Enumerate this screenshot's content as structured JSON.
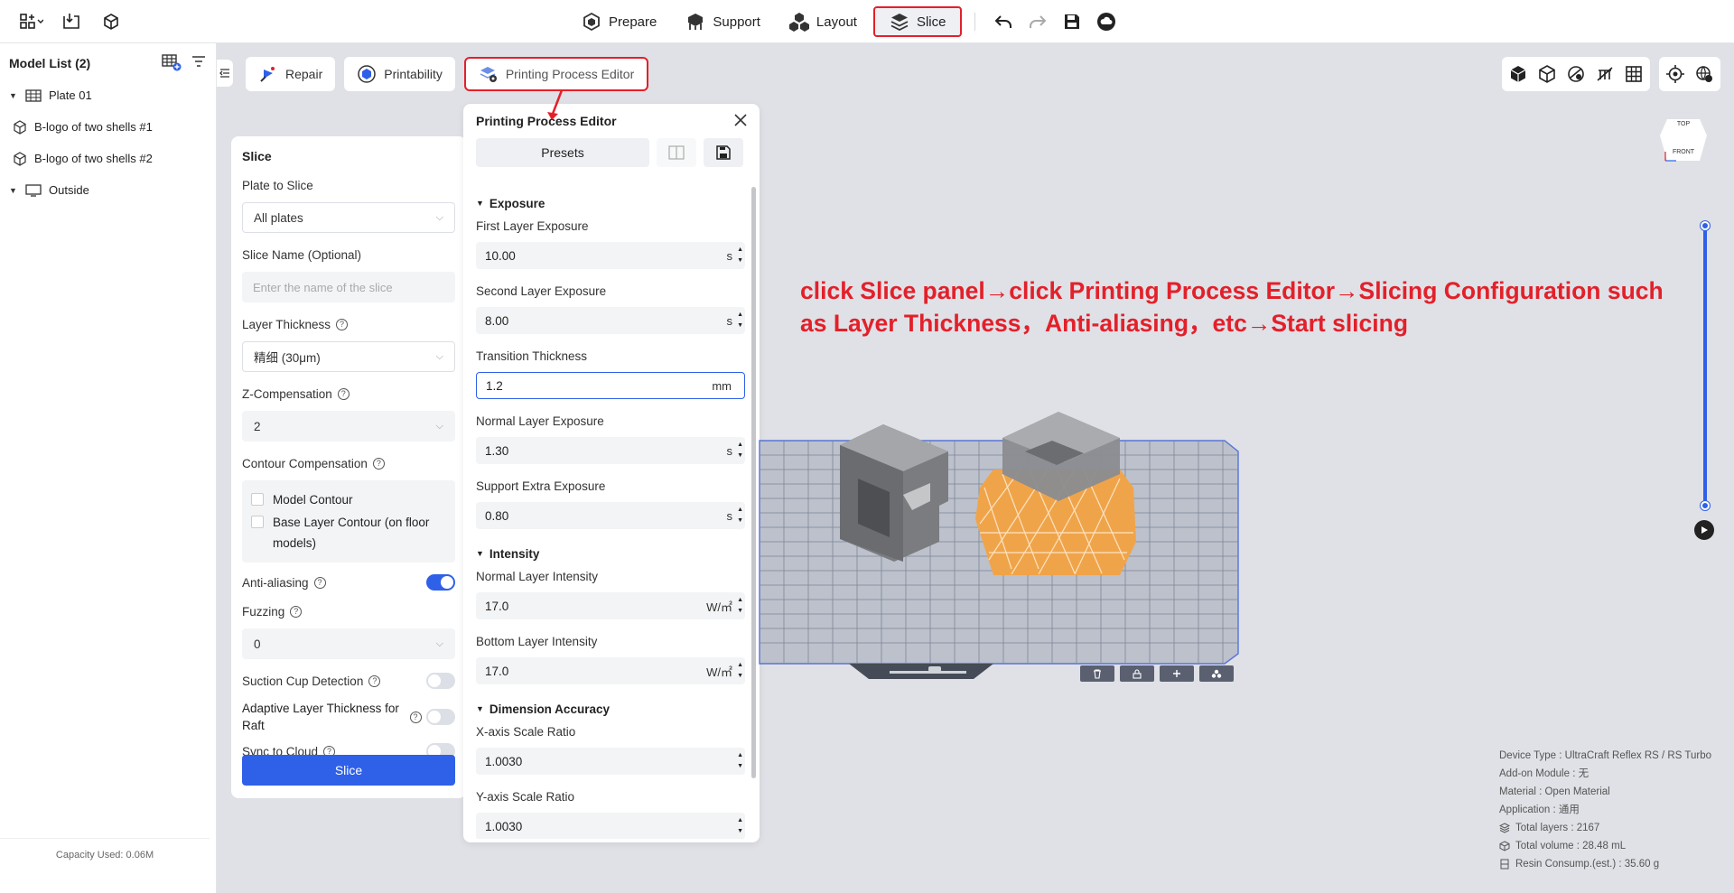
{
  "topbar": {
    "tabs": [
      {
        "label": "Prepare",
        "icon": "prepare-icon"
      },
      {
        "label": "Support",
        "icon": "support-icon"
      },
      {
        "label": "Layout",
        "icon": "layout-icon"
      },
      {
        "label": "Slice",
        "icon": "slice-icon",
        "active": true
      }
    ]
  },
  "model_list": {
    "title": "Model List (2)",
    "items": [
      {
        "label": "Plate 01",
        "type": "plate"
      },
      {
        "label": "B-logo of two shells #1",
        "type": "model"
      },
      {
        "label": "B-logo of two shells #2",
        "type": "model"
      },
      {
        "label": "Outside",
        "type": "outside"
      }
    ],
    "capacity": "Capacity Used: 0.06M"
  },
  "subtools": {
    "repair": "Repair",
    "printability": "Printability",
    "ppe": "Printing Process Editor"
  },
  "slice_panel": {
    "title": "Slice",
    "plate_to_slice_label": "Plate to Slice",
    "plate_to_slice_value": "All plates",
    "slice_name_label": "Slice Name (Optional)",
    "slice_name_placeholder": "Enter the name of the slice",
    "layer_thickness_label": "Layer Thickness",
    "layer_thickness_value": "精细 (30μm)",
    "z_comp_label": "Z-Compensation",
    "z_comp_value": "2",
    "contour_label": "Contour Compensation",
    "model_contour": "Model Contour",
    "base_contour": "Base Layer Contour (on floor models)",
    "anti_aliasing": "Anti-aliasing",
    "anti_aliasing_on": true,
    "fuzzing_label": "Fuzzing",
    "fuzzing_value": "0",
    "suction_cup": "Suction Cup Detection",
    "adaptive": "Adaptive Layer Thickness for Raft",
    "sync": "Sync to Cloud",
    "slice_button": "Slice"
  },
  "ppe_panel": {
    "title": "Printing Process Editor",
    "presets": "Presets",
    "sections": {
      "exposure": "Exposure",
      "intensity": "Intensity",
      "dimension": "Dimension Accuracy"
    },
    "fields": {
      "first_layer_exposure": {
        "label": "First Layer Exposure",
        "value": "10.00",
        "unit": "s"
      },
      "second_layer_exposure": {
        "label": "Second Layer Exposure",
        "value": "8.00",
        "unit": "s"
      },
      "transition_thickness": {
        "label": "Transition Thickness",
        "value": "1.2",
        "unit": "mm"
      },
      "normal_layer_exposure": {
        "label": "Normal Layer Exposure",
        "value": "1.30",
        "unit": "s"
      },
      "support_extra_exposure": {
        "label": "Support Extra Exposure",
        "value": "0.80",
        "unit": "s"
      },
      "normal_layer_intensity": {
        "label": "Normal Layer Intensity",
        "value": "17.0",
        "unit": "W/㎡"
      },
      "bottom_layer_intensity": {
        "label": "Bottom Layer Intensity",
        "value": "17.0",
        "unit": "W/㎡"
      },
      "x_scale": {
        "label": "X-axis Scale Ratio",
        "value": "1.0030",
        "unit": ""
      },
      "y_scale": {
        "label": "Y-axis Scale Ratio",
        "value": "1.0030",
        "unit": ""
      }
    }
  },
  "annotation": "click Slice panel→click Printing Process Editor→Slicing Configuration such\nas Layer Thickness，Anti-aliasing，etc→Start slicing",
  "cube_labels": {
    "top": "TOP",
    "front": "FRONT"
  },
  "info": {
    "device": "Device Type : UltraCraft Reflex RS / RS Turbo",
    "addon": "Add-on Module : 无",
    "material": "Material : Open Material",
    "application": "Application : 通用",
    "layers": "Total layers : 2167",
    "volume": "Total volume : 28.48 mL",
    "resin": "Resin Consump.(est.) : 35.60 g"
  },
  "colors": {
    "accent": "#2f60e8",
    "highlight": "#e3202a",
    "support": "#f0a44a",
    "model": "#8a8a8a"
  }
}
